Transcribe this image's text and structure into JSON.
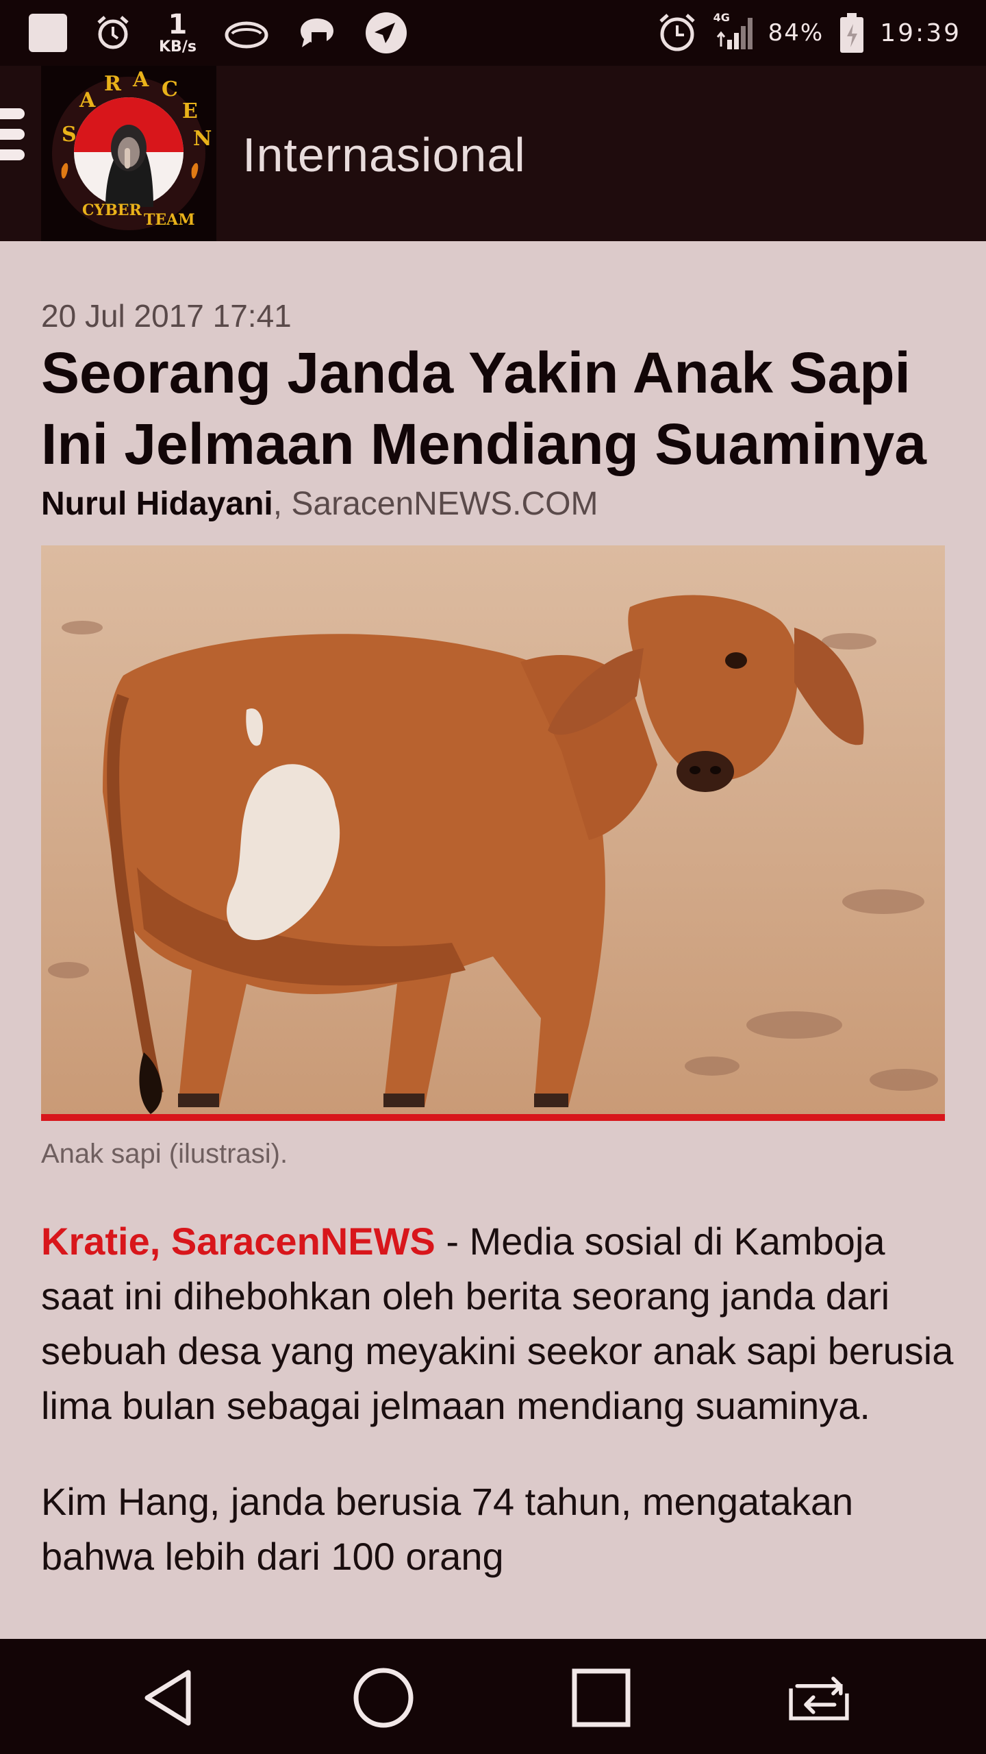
{
  "status_bar": {
    "net_speed_value": "1",
    "net_speed_unit": "KB/s",
    "network_type": "4G",
    "battery_percent": "84%",
    "time": "19:39",
    "left_icons": [
      "notification-square-icon",
      "alarm-icon",
      "cloud-icon",
      "messenger-icon",
      "telegram-icon"
    ],
    "right_icons": [
      "alarm-icon",
      "signal-icon",
      "battery-icon"
    ]
  },
  "header": {
    "section_title": "Internasional",
    "logo_top_text": "SARACEN",
    "logo_bottom_text": "CYBER TEAM"
  },
  "article": {
    "date": "20 Jul 2017 17:41",
    "headline": "Seorang Janda Yakin Anak Sapi Ini Jelmaan Mendiang Suaminya",
    "author": "Nurul Hidayani",
    "source": ", SaracenNEWS.COM",
    "image_caption": "Anak sapi (ilustrasi).",
    "dateline": "Kratie, SaracenNEWS",
    "paragraph1": " - Media sosial di Kamboja saat ini dihebohkan oleh berita seorang janda dari sebuah desa yang meyakini seekor anak sapi berusia lima bulan sebagai jelmaan mendiang suaminya.",
    "paragraph2": "Kim Hang, janda berusia 74 tahun, mengatakan bahwa lebih dari 100 orang"
  },
  "nav_bar": {
    "buttons": [
      "back-icon",
      "home-icon",
      "recents-icon",
      "switch-app-icon"
    ]
  },
  "colors": {
    "accent_red": "#d8161b",
    "header_bg": "#1f0c0d",
    "page_bg": "#dccaca"
  }
}
